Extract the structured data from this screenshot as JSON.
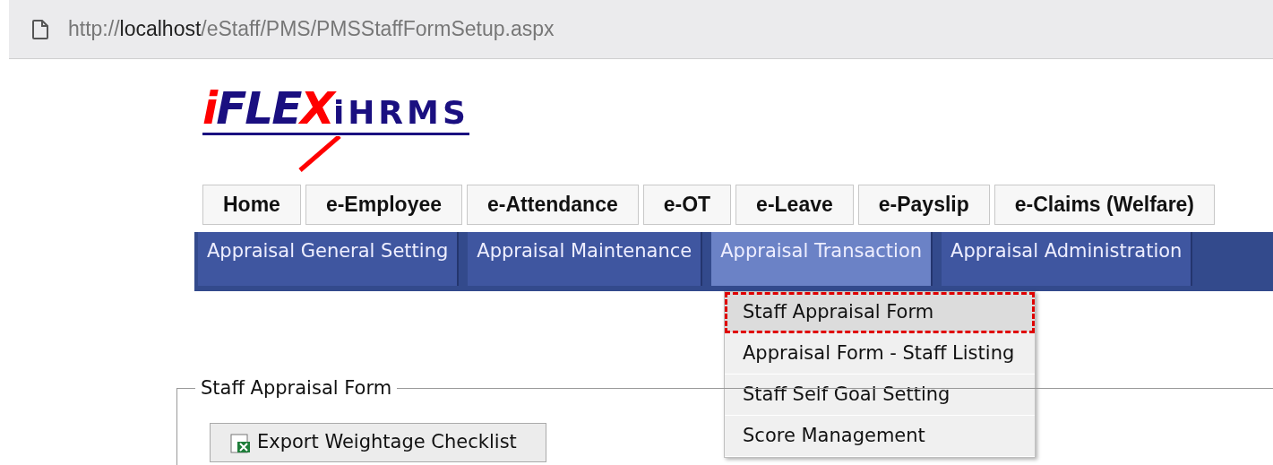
{
  "address_bar": {
    "scheme": "http://",
    "host": "localhost",
    "path": "/eStaff/PMS/PMSStaffFormSetup.aspx"
  },
  "logo": {
    "parts": [
      {
        "text": "i",
        "color": "#ff0000"
      },
      {
        "text": "FLE",
        "color": "#1a0f80"
      },
      {
        "text": "X",
        "color": "#ff0000"
      },
      {
        "text": "iHRMS",
        "color": "#1a0f80"
      }
    ]
  },
  "main_tabs": [
    {
      "label": "Home"
    },
    {
      "label": "e-Employee"
    },
    {
      "label": "e-Attendance"
    },
    {
      "label": "e-OT"
    },
    {
      "label": "e-Leave"
    },
    {
      "label": "e-Payslip"
    },
    {
      "label": "e-Claims (Welfare)"
    }
  ],
  "sub_menu": [
    {
      "label": "Appraisal General Setting",
      "selected": false
    },
    {
      "label": "Appraisal Maintenance",
      "selected": false
    },
    {
      "label": "Appraisal Transaction",
      "selected": true
    },
    {
      "label": "Appraisal Administration",
      "selected": false
    }
  ],
  "dropdown": [
    {
      "label": "Staff Appraisal Form",
      "highlighted": true
    },
    {
      "label": "Appraisal Form - Staff Listing",
      "highlighted": false
    },
    {
      "label": "Staff Self Goal Setting",
      "highlighted": false
    },
    {
      "label": "Score Management",
      "highlighted": false
    }
  ],
  "fieldset": {
    "legend": "Staff Appraisal Form",
    "button": "Export Weightage Checklist"
  }
}
